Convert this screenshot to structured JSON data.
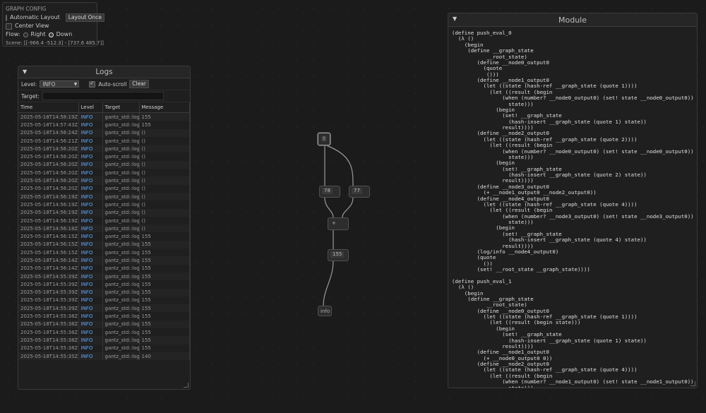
{
  "graph_config": {
    "title": "GRAPH CONFIG",
    "automatic_layout_label": "Automatic Layout",
    "automatic_layout_checked": false,
    "layout_once_label": "Layout Once",
    "center_view_label": "Center View",
    "center_view_checked": false,
    "flow_label": "Flow:",
    "flow_right": "Right",
    "flow_down": "Down",
    "flow_selected": "Down",
    "scene_text": "Scene: [[-966.4 -512.3] - [737.6 485.7]]"
  },
  "logs": {
    "title": "Logs",
    "level_label": "Level:",
    "level_value": "INFO",
    "autoscroll_label": "Auto-scroll",
    "autoscroll_checked": true,
    "clear_label": "Clear",
    "target_label": "Target:",
    "target_value": "",
    "columns": [
      "Time",
      "Level",
      "Target",
      "Message"
    ],
    "rows": [
      [
        "2025-05-18T14:58:19Z",
        "INFO",
        "gantz_std::log",
        "155"
      ],
      [
        "2025-05-18T14:57:43Z",
        "INFO",
        "gantz_std::log",
        "155"
      ],
      [
        "2025-05-18T14:56:24Z",
        "INFO",
        "gantz_std::log",
        "()"
      ],
      [
        "2025-05-18T14:56:21Z",
        "INFO",
        "gantz_std::log",
        "()"
      ],
      [
        "2025-05-18T14:56:20Z",
        "INFO",
        "gantz_std::log",
        "()"
      ],
      [
        "2025-05-18T14:56:20Z",
        "INFO",
        "gantz_std::log",
        "()"
      ],
      [
        "2025-05-18T14:56:20Z",
        "INFO",
        "gantz_std::log",
        "()"
      ],
      [
        "2025-05-18T14:56:20Z",
        "INFO",
        "gantz_std::log",
        "()"
      ],
      [
        "2025-05-18T14:56:20Z",
        "INFO",
        "gantz_std::log",
        "()"
      ],
      [
        "2025-05-18T14:56:20Z",
        "INFO",
        "gantz_std::log",
        "()"
      ],
      [
        "2025-05-18T14:56:19Z",
        "INFO",
        "gantz_std::log",
        "()"
      ],
      [
        "2025-05-18T14:56:19Z",
        "INFO",
        "gantz_std::log",
        "()"
      ],
      [
        "2025-05-18T14:56:19Z",
        "INFO",
        "gantz_std::log",
        "()"
      ],
      [
        "2025-05-18T14:56:19Z",
        "INFO",
        "gantz_std::log",
        "()"
      ],
      [
        "2025-05-18T14:56:18Z",
        "INFO",
        "gantz_std::log",
        "()"
      ],
      [
        "2025-05-18T14:56:15Z",
        "INFO",
        "gantz_std::log",
        "155"
      ],
      [
        "2025-05-18T14:56:15Z",
        "INFO",
        "gantz_std::log",
        "155"
      ],
      [
        "2025-05-18T14:56:15Z",
        "INFO",
        "gantz_std::log",
        "155"
      ],
      [
        "2025-05-18T14:56:14Z",
        "INFO",
        "gantz_std::log",
        "155"
      ],
      [
        "2025-05-18T14:56:14Z",
        "INFO",
        "gantz_std::log",
        "155"
      ],
      [
        "2025-05-18T14:55:39Z",
        "INFO",
        "gantz_std::log",
        "155"
      ],
      [
        "2025-05-18T14:55:39Z",
        "INFO",
        "gantz_std::log",
        "155"
      ],
      [
        "2025-05-18T14:55:39Z",
        "INFO",
        "gantz_std::log",
        "155"
      ],
      [
        "2025-05-18T14:55:39Z",
        "INFO",
        "gantz_std::log",
        "155"
      ],
      [
        "2025-05-18T14:55:39Z",
        "INFO",
        "gantz_std::log",
        "155"
      ],
      [
        "2025-05-18T14:55:38Z",
        "INFO",
        "gantz_std::log",
        "155"
      ],
      [
        "2025-05-18T14:55:38Z",
        "INFO",
        "gantz_std::log",
        "155"
      ],
      [
        "2025-05-18T14:55:38Z",
        "INFO",
        "gantz_std::log",
        "155"
      ],
      [
        "2025-05-18T14:55:38Z",
        "INFO",
        "gantz_std::log",
        "155"
      ],
      [
        "2025-05-18T14:55:38Z",
        "INFO",
        "gantz_std::log",
        "155"
      ],
      [
        "2025-05-18T14:55:35Z",
        "INFO",
        "gantz_std::log",
        "140"
      ]
    ]
  },
  "graph": {
    "nodes": [
      {
        "id": "bang",
        "label": "!"
      },
      {
        "id": "n78",
        "label": "78"
      },
      {
        "id": "n77",
        "label": "77"
      },
      {
        "id": "add",
        "label": "+"
      },
      {
        "id": "n155",
        "label": "155"
      },
      {
        "id": "info",
        "label": "info"
      }
    ]
  },
  "module": {
    "title": "Module",
    "code": "(define push_eval_0\n  (λ ()\n    (begin\n     (define __graph_state\n           __root_state)\n        (define __node0_output0\n          (quote\n           ()))\n        (define __node1_output0\n          (let ((state (hash-ref __graph_state (quote 1))))\n            (let ((result (begin\n                (when (number? __node0_output0) (set! state __node0_output0))\n                  state)))\n              (begin\n                (set! __graph_state\n                  (hash-insert __graph_state (quote 1) state))\n                result))))\n        (define __node2_output0\n          (let ((state (hash-ref __graph_state (quote 2))))\n            (let ((result (begin\n                (when (number? __node0_output0) (set! state __node0_output0))\n                  state)))\n              (begin\n                (set! __graph_state\n                  (hash-insert __graph_state (quote 2) state))\n                result))))\n        (define __node3_output0\n          (+ __node1_output0 __node2_output0))\n        (define __node4_output0\n          (let ((state (hash-ref __graph_state (quote 4))))\n            (let ((result (begin\n                (when (number? __node3_output0) (set! state __node3_output0))\n                  state)))\n              (begin\n                (set! __graph_state\n                  (hash-insert __graph_state (quote 4) state))\n                result))))\n        (log/info __node4_output0)\n        (quote\n          ())\n        (set! __root_state __graph_state))))\n\n(define push_eval_1\n  (λ ()\n    (begin\n     (define __graph_state\n           __root_state)\n        (define __node0_output0\n          (let ((state (hash-ref __graph_state (quote 1))))\n            (let ((result (begin state)))\n              (begin\n                (set! __graph_state\n                  (hash-insert __graph_state (quote 1) state))\n                result))))\n        (define __node1_output0\n          (+ __node0_output0 0))\n        (define __node2_output0\n          (let ((state (hash-ref __graph_state (quote 4))))\n            (let ((result (begin\n                (when (number? __node1_output0) (set! state __node1_output0))\n                  state)))\n              (begin"
  }
}
